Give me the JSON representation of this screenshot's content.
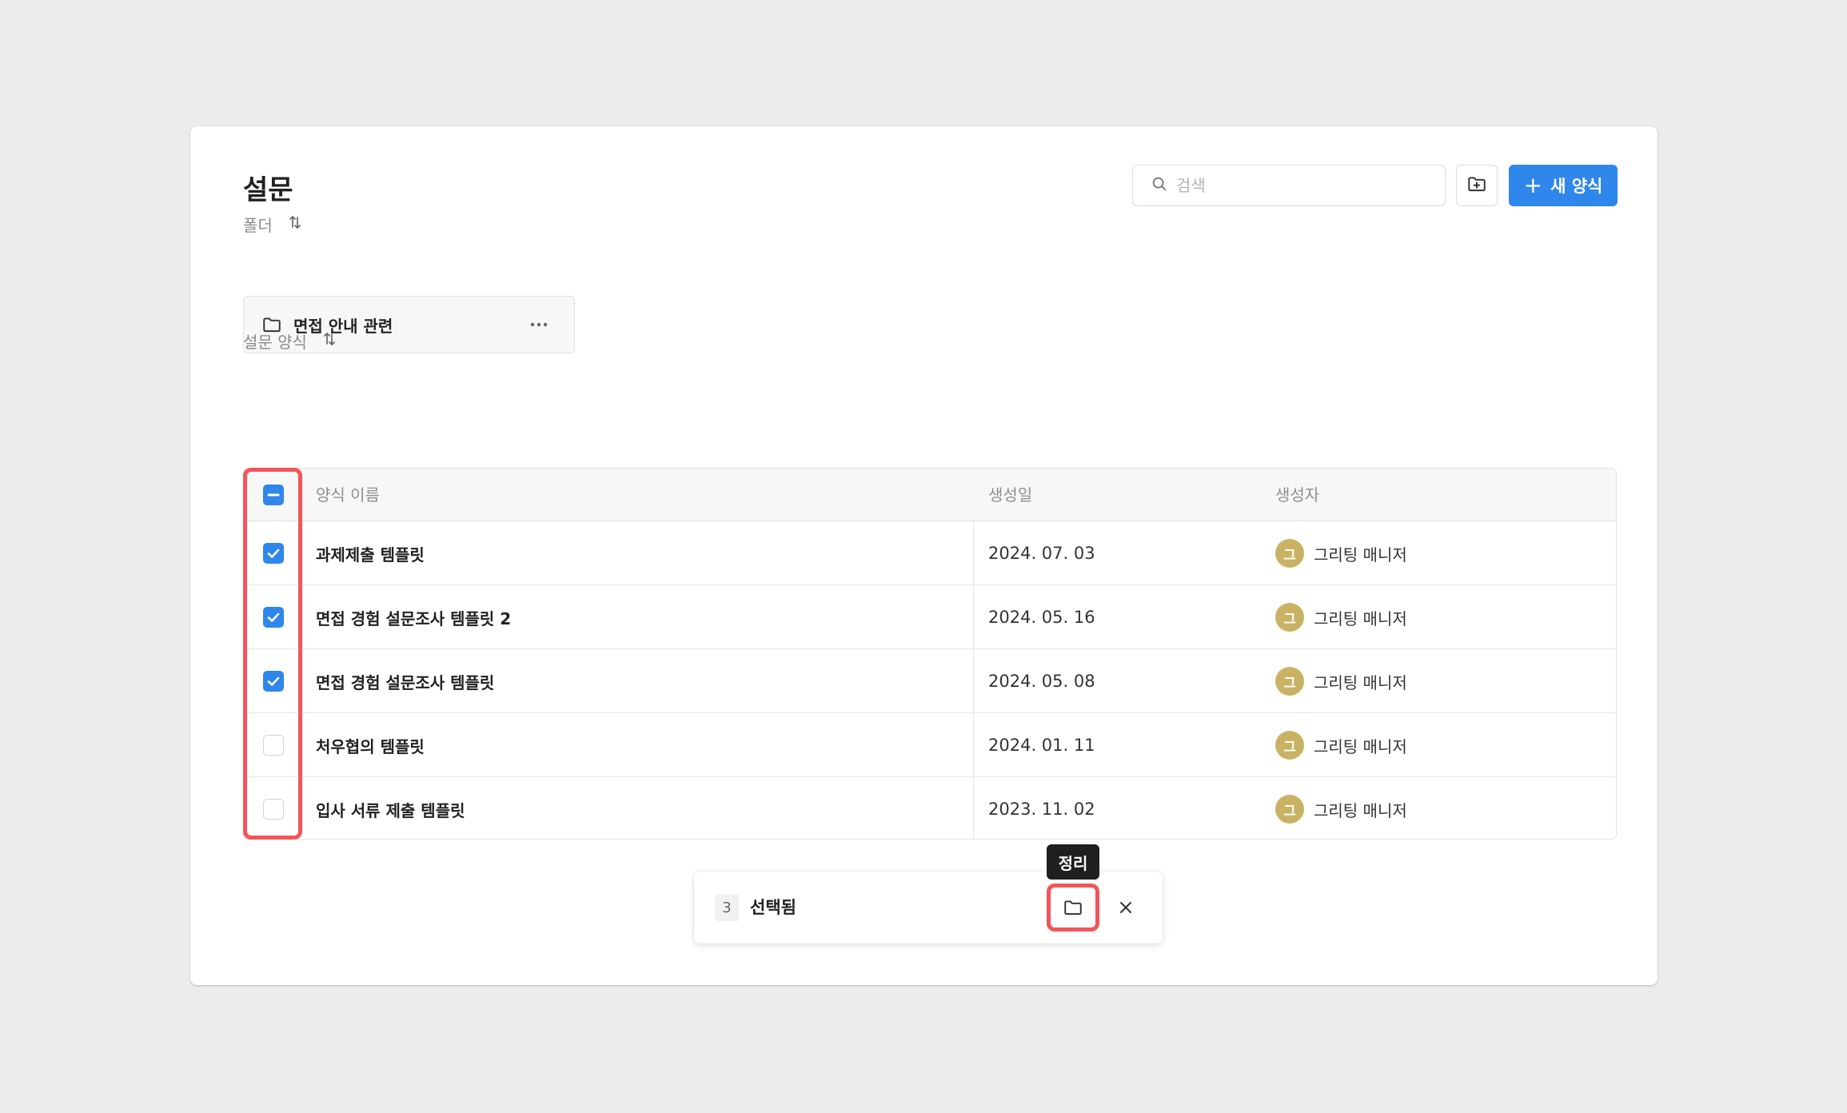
{
  "page": {
    "title": "설문",
    "search_placeholder": "검색",
    "new_form_label": "새 양식"
  },
  "folders": {
    "label": "폴더",
    "items": [
      {
        "name": "면접 안내 관련"
      }
    ]
  },
  "forms": {
    "label": "설문 양식",
    "columns": {
      "name": "양식 이름",
      "created": "생성일",
      "creator": "생성자"
    },
    "rows": [
      {
        "name": "과제제출 템플릿",
        "created": "2024. 07. 03",
        "avatar": "그",
        "creator": "그리팅 매니저",
        "checked": true
      },
      {
        "name": "면접 경험 설문조사 템플릿 2",
        "created": "2024. 05. 16",
        "avatar": "그",
        "creator": "그리팅 매니저",
        "checked": true
      },
      {
        "name": "면접 경험 설문조사 템플릿",
        "created": "2024. 05. 08",
        "avatar": "그",
        "creator": "그리팅 매니저",
        "checked": true
      },
      {
        "name": "처우협의 템플릿",
        "created": "2024. 01. 11",
        "avatar": "그",
        "creator": "그리팅 매니저",
        "checked": false
      },
      {
        "name": "입사 서류 제출 템플릿",
        "created": "2023. 11. 02",
        "avatar": "그",
        "creator": "그리팅 매니저",
        "checked": false
      }
    ]
  },
  "selection_bar": {
    "count": "3",
    "label": "선택됨",
    "tooltip": "정리"
  },
  "colors": {
    "accent": "#2f86eb",
    "highlight": "#f2555a",
    "avatar": "#c9b263"
  }
}
